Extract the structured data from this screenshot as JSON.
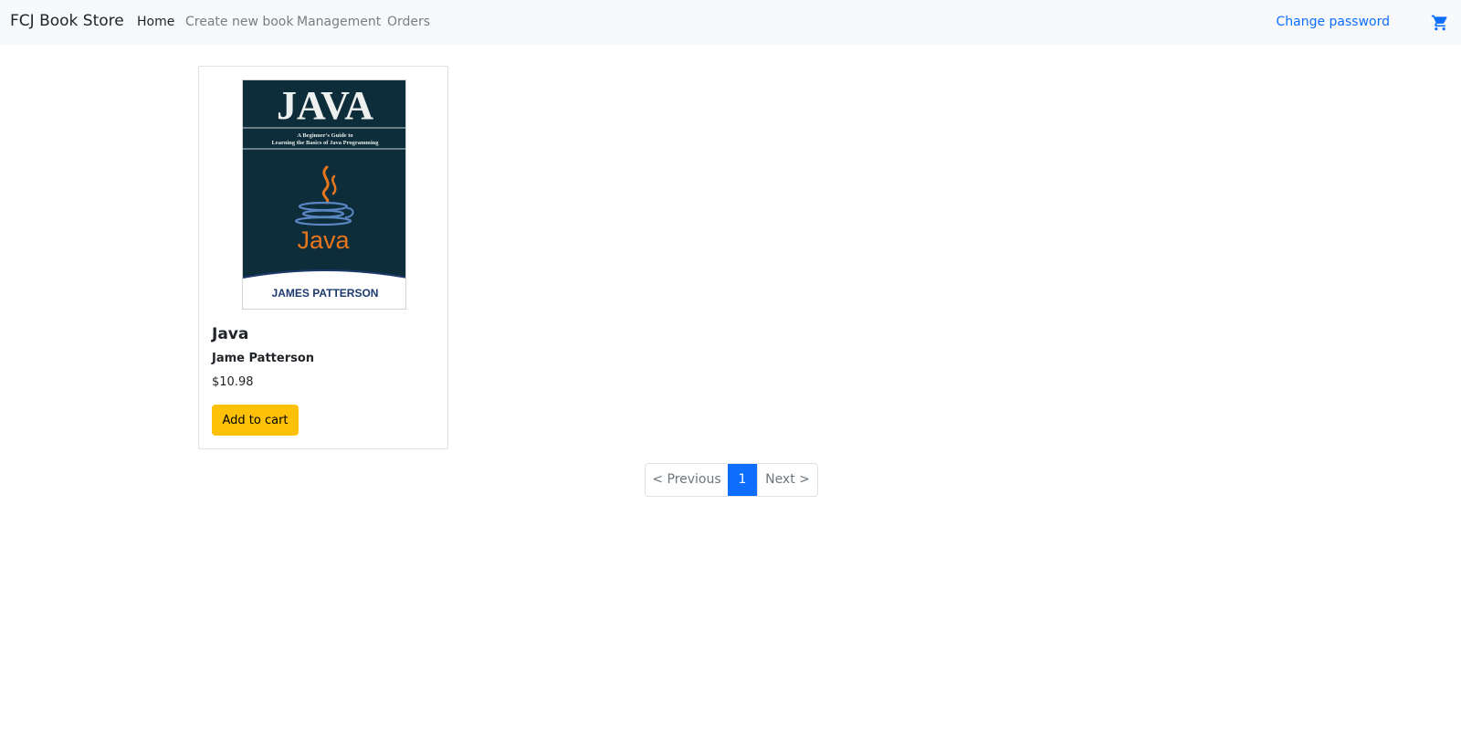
{
  "navbar": {
    "brand": "FCJ Book Store",
    "links": [
      {
        "label": "Home",
        "active": true
      },
      {
        "label": "Create new book",
        "active": false
      },
      {
        "label": "Management",
        "active": false
      },
      {
        "label": "Orders",
        "active": false
      }
    ],
    "change_password": "Change password",
    "cart_icon": "shopping-cart-icon",
    "link_color": "#0d6efd"
  },
  "books": [
    {
      "title": "Java",
      "author": "Jame Patterson",
      "price": "$10.98",
      "button_label": "Add to cart",
      "cover": {
        "heading": "JAVA",
        "subtitle_line1": "A Beginner's Guide to",
        "subtitle_line2": "Learning the Basics of Java Programming",
        "logo_text": "Java",
        "author_line": "JAMES PATTERSON"
      }
    }
  ],
  "pagination": {
    "previous": "< Previous",
    "current": "1",
    "next": "Next >",
    "active_color": "#0d6efd"
  },
  "colors": {
    "navbar_bg": "#f8f9fa",
    "button_bg": "#ffc107",
    "cover_bg": "#0e2d3a",
    "logo_orange": "#e8761c"
  }
}
